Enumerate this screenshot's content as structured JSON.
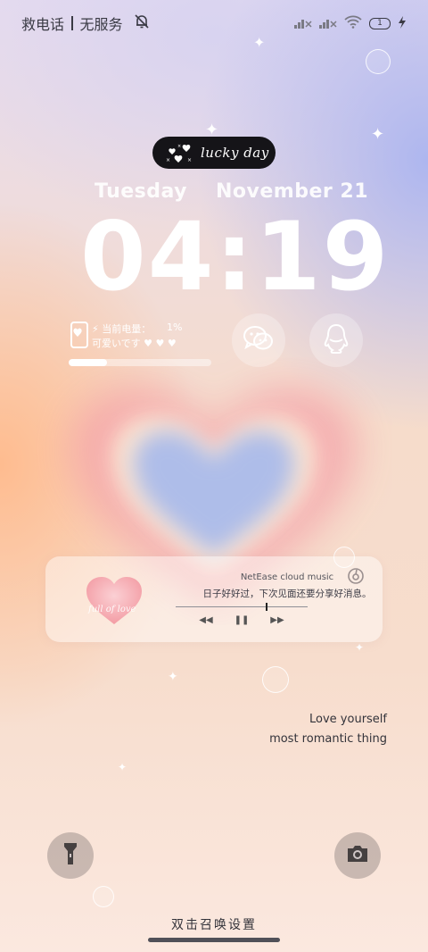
{
  "status_bar": {
    "left_text": "救电话",
    "carrier": "无服务",
    "battery_level": "1",
    "icons": [
      "mute-bell-icon",
      "signal-x-icon",
      "signal-x-icon",
      "wifi-icon",
      "battery-icon",
      "charging-icon"
    ]
  },
  "badge": {
    "text": "lucky day"
  },
  "date": {
    "weekday": "Tuesday",
    "month_day": "November 21"
  },
  "clock": {
    "time": "04:19"
  },
  "battery_widget": {
    "label": "当前电量：",
    "value": "1%",
    "cute": "可爱いです ♥ ♥ ♥",
    "level": 0.27
  },
  "shortcuts": {
    "left": "wechat-icon",
    "right": "qq-penguin-icon"
  },
  "music": {
    "source": "NetEase cloud music",
    "lyric": "日子好好过，下次见面还要分享好消息。",
    "art_text": "full of love",
    "progress": 0.68
  },
  "quote": {
    "line1": "Love yourself",
    "line2": "most romantic thing"
  },
  "bottom": {
    "hint": "双击召唤设置",
    "left_icon": "flashlight-icon",
    "right_icon": "camera-icon"
  },
  "colors": {
    "accent_pink": "#f5a3a8",
    "accent_blue": "#aebde9",
    "pill_bg": "#151418"
  }
}
